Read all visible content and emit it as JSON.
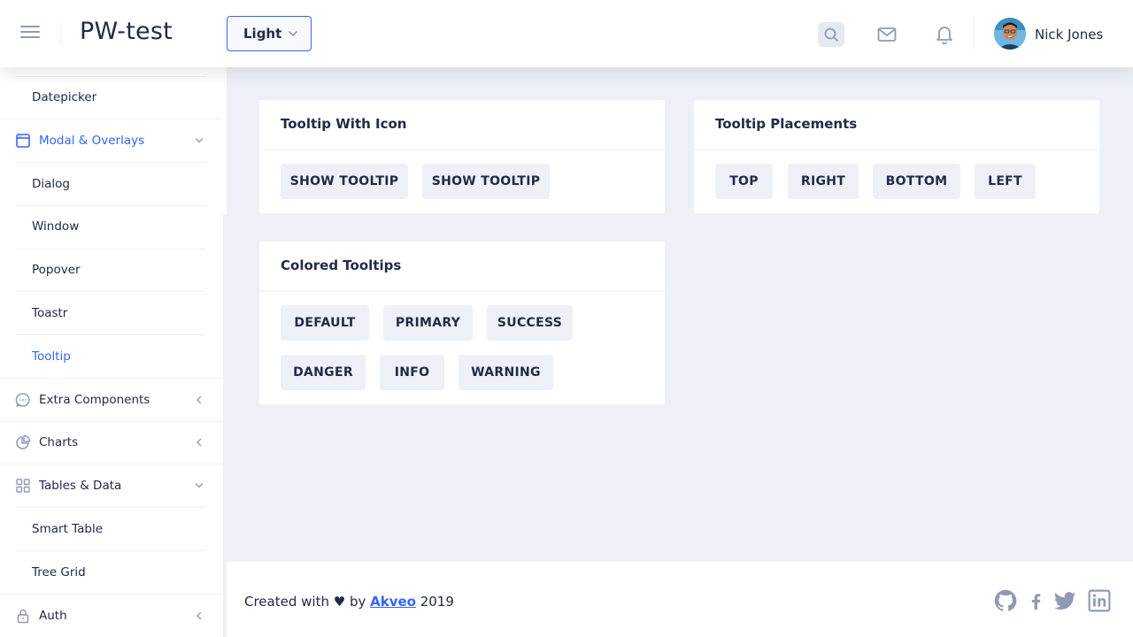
{
  "header": {
    "app_title": "PW-test",
    "theme": {
      "selected": "Light"
    },
    "user": {
      "name": "Nick Jones"
    }
  },
  "sidebar": {
    "items": [
      {
        "label": "Datepicker"
      },
      {
        "label": "Modal & Overlays"
      },
      {
        "label": "Dialog"
      },
      {
        "label": "Window"
      },
      {
        "label": "Popover"
      },
      {
        "label": "Toastr"
      },
      {
        "label": "Tooltip"
      },
      {
        "label": "Extra Components"
      },
      {
        "label": "Charts"
      },
      {
        "label": "Tables & Data"
      },
      {
        "label": "Smart Table"
      },
      {
        "label": "Tree Grid"
      },
      {
        "label": "Auth"
      }
    ]
  },
  "cards": {
    "tooltip_with_icon": {
      "title": "Tooltip With Icon",
      "buttons": [
        "SHOW TOOLTIP",
        "SHOW TOOLTIP"
      ]
    },
    "tooltip_placements": {
      "title": "Tooltip Placements",
      "buttons": [
        "TOP",
        "RIGHT",
        "BOTTOM",
        "LEFT"
      ]
    },
    "colored_tooltips": {
      "title": "Colored Tooltips",
      "buttons": [
        "DEFAULT",
        "PRIMARY",
        "SUCCESS",
        "DANGER",
        "INFO",
        "WARNING"
      ]
    }
  },
  "footer": {
    "prefix": "Created with ♥ by ",
    "link": "Akveo",
    "year": " 2019"
  },
  "colors": {
    "primary": "#3366ff",
    "background": "#edf1f7",
    "text": "#222b45",
    "hint": "#8f9bb3"
  }
}
